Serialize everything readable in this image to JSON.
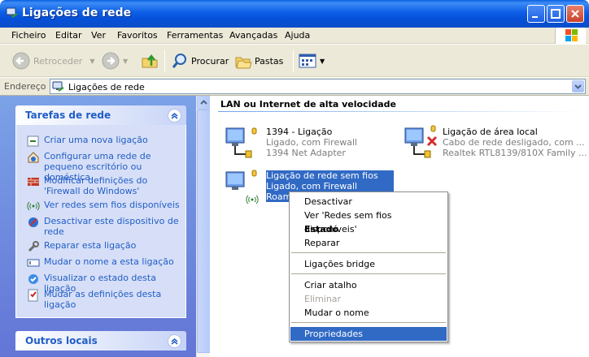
{
  "window": {
    "title": "Ligações de rede"
  },
  "menu": [
    "Ficheiro",
    "Editar",
    "Ver",
    "Favoritos",
    "Ferramentas",
    "Avançadas",
    "Ajuda"
  ],
  "toolbar": {
    "back": "Retroceder",
    "search": "Procurar",
    "folders": "Pastas"
  },
  "address": {
    "label": "Endereço",
    "value": "Ligações de rede"
  },
  "tasks": {
    "title": "Tarefas de rede",
    "items": [
      "Criar uma nova ligação",
      "Configurar uma rede de pequeno escritório ou doméstica",
      "Modificar definições do 'Firewall do Windows'",
      "Ver redes sem fios disponíveis",
      "Desactivar este dispositivo de rede",
      "Reparar esta ligação",
      "Mudar o nome a esta ligação",
      "Visualizar o estado desta ligação",
      "Mudar as definições desta ligação"
    ]
  },
  "other_places": {
    "title": "Outros locais"
  },
  "section": {
    "title": "LAN ou Internet de alta velocidade"
  },
  "connections": [
    {
      "name": "1394 - Ligação",
      "status": "Ligado, com Firewall",
      "device": "1394 Net Adapter"
    },
    {
      "name": "Ligação de área local",
      "status": "Cabo de rede desligado, com ...",
      "device": "Realtek RTL8139/810X Family ..."
    },
    {
      "name": "Ligação de rede sem fios",
      "status": "Ligado, com Firewall",
      "device": "Roam"
    }
  ],
  "context_menu": {
    "items": [
      "Desactivar",
      "Ver 'Redes sem fios disponíveis'",
      "Estado",
      "Reparar",
      "Ligações bridge",
      "Criar atalho",
      "Eliminar",
      "Mudar o nome",
      "Propriedades"
    ]
  },
  "colors": {
    "titlebar": "#0a5fe0",
    "selection": "#316ac5",
    "link": "#215dc6",
    "panel": "#6d8fe0"
  },
  "icons": [
    "network-connections-icon",
    "back-icon",
    "forward-icon",
    "up-folder-icon",
    "search-icon",
    "folders-icon",
    "views-icon",
    "windows-logo-icon",
    "collapse-icon"
  ]
}
